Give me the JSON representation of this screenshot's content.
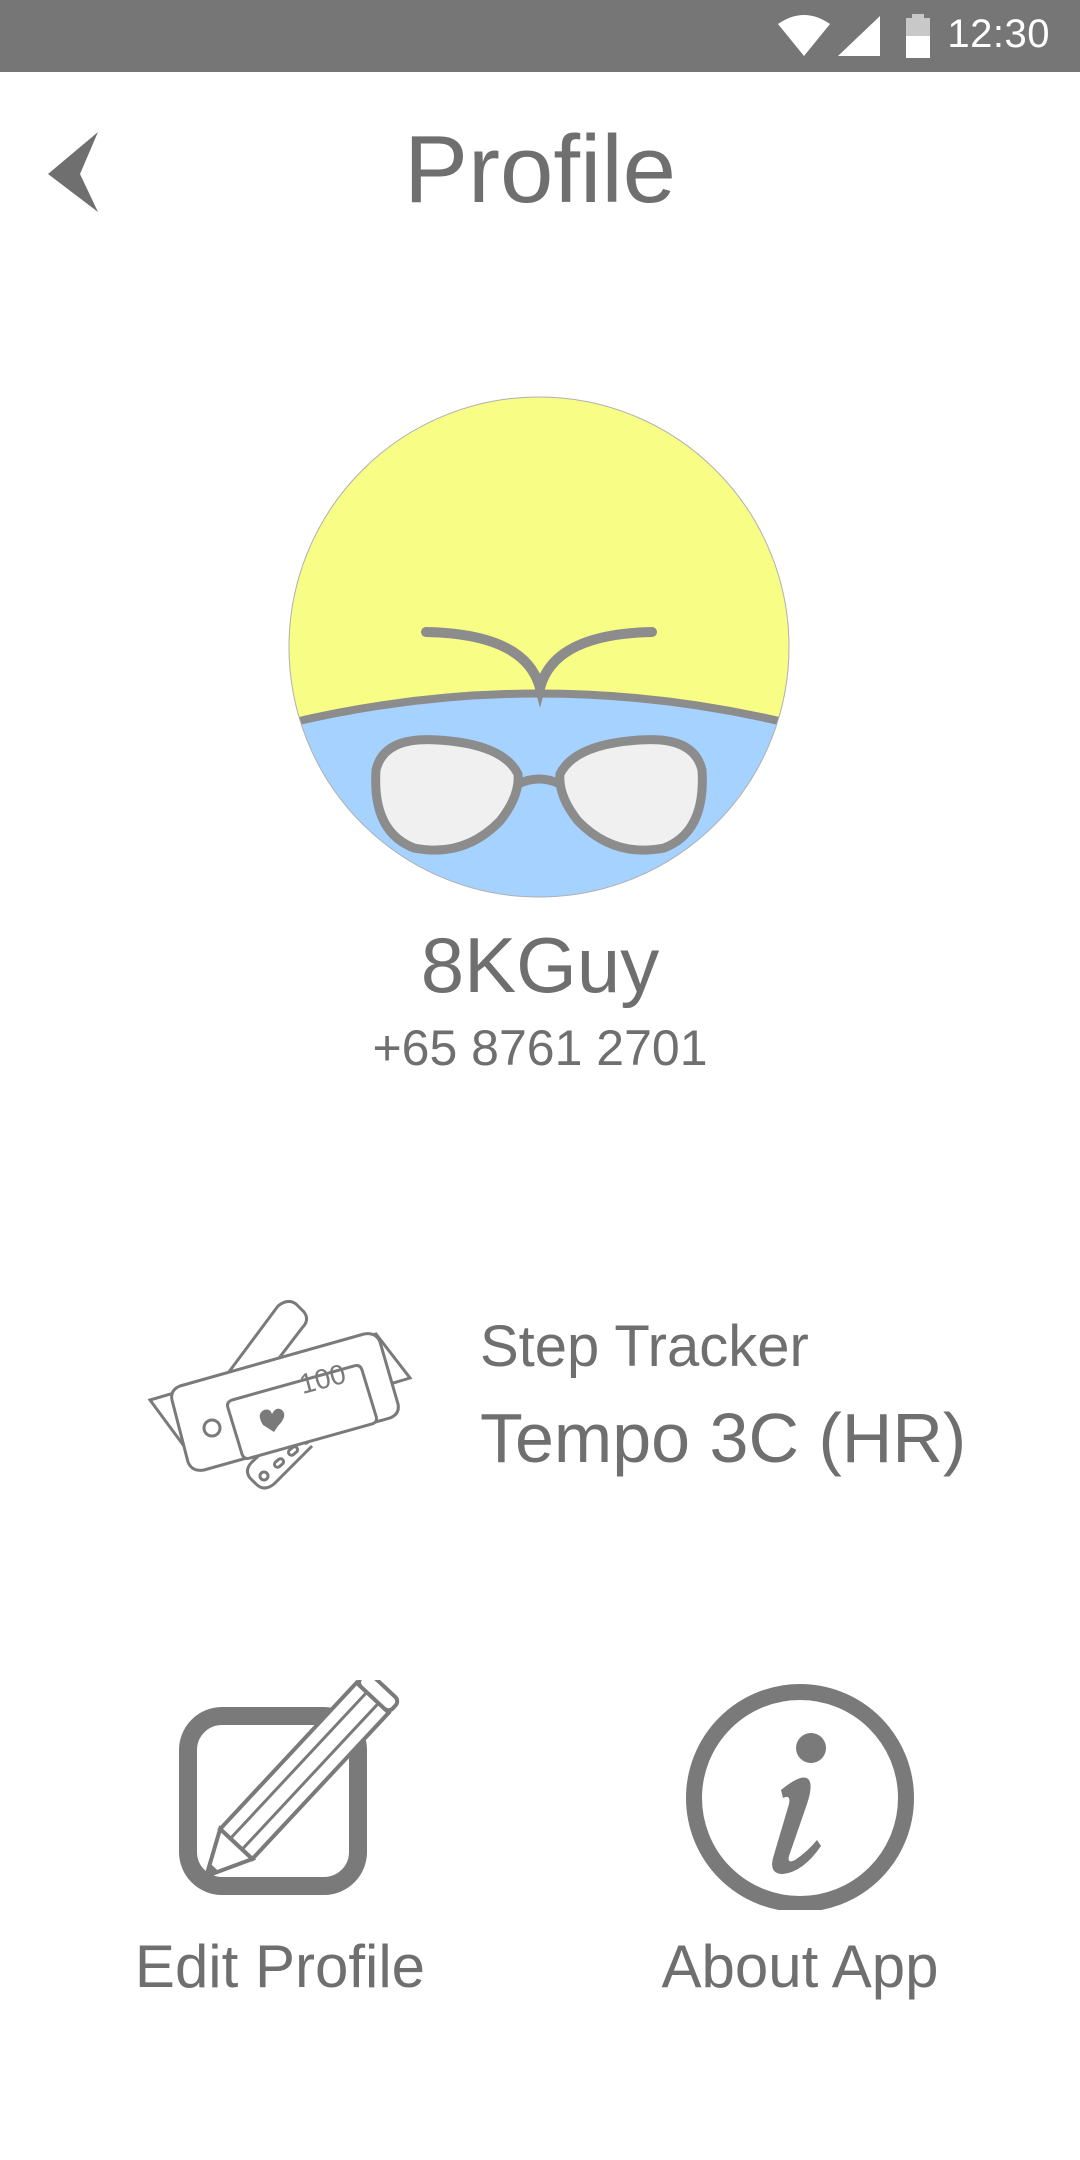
{
  "status_bar": {
    "time": "12:30",
    "icons": [
      "wifi-icon",
      "signal-icon",
      "battery-icon"
    ]
  },
  "header": {
    "title": "Profile",
    "back_icon": "chevron-left-icon"
  },
  "profile": {
    "name": "8KGuy",
    "phone": "+65 8761 2701",
    "avatar_colors": {
      "top": "#f8fd85",
      "bottom": "#a5d2ff",
      "lines": "#8c8c8c",
      "lens": "#f0f0f0"
    }
  },
  "tracker": {
    "label": "Step Tracker",
    "model": "Tempo 3C (HR)",
    "screen_value": "100"
  },
  "actions": {
    "edit_label": "Edit Profile",
    "about_label": "About App"
  },
  "colors": {
    "status_bar": "#767676",
    "text": "#6f6f6f",
    "icon": "#7a7a7a"
  }
}
